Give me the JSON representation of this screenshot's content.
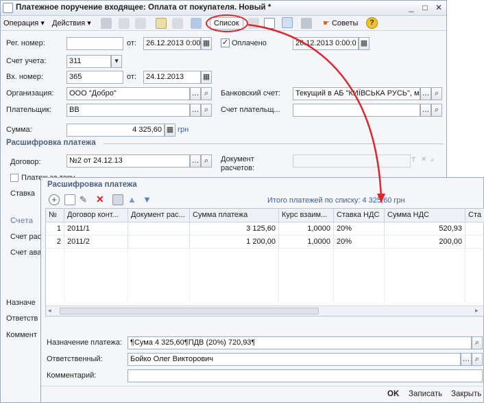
{
  "main_window": {
    "title": "Платежное поручение входящее: Оплата от покупателя. Новый *",
    "toolbar": {
      "operation_label": "Операция",
      "actions_label": "Действия",
      "list_label": "Список",
      "tips_label": "Советы"
    },
    "fields": {
      "reg_number_label": "Рег. номер:",
      "reg_number_value": "",
      "from_label": "от:",
      "reg_date": "26.12.2013 0:00",
      "paid_label": "Оплачено",
      "paid_date": "26.12.2013 0:00:0",
      "account_label": "Счет учета:",
      "account_value": "311",
      "incoming_number_label": "Вх. номер:",
      "incoming_number_value": "365",
      "from2_label": "от:",
      "incoming_date": "24.12.2013",
      "organization_label": "Организация:",
      "organization_value": "ООО \"Добро\"",
      "bank_account_label": "Банковский счет:",
      "bank_account_value": "Текущий в АБ \"КИЇВСЬКА РУСЬ\", м",
      "payer_label": "Плательщик:",
      "payer_value": "ВВ",
      "payer_account_label": "Счет плательщ...",
      "payer_account_value": "",
      "amount_label": "Сумма:",
      "amount_value": "4 325,60",
      "currency": "грн"
    },
    "breakdown_section": "Расшифровка платежа",
    "contract_label": "Договор:",
    "contract_value": "№2 от 24.12.13",
    "settlement_doc_label": "Документ расчетов:",
    "settlement_doc_value": "",
    "left_partial": {
      "payment_checkbox_label": "Платеж за тару",
      "rate_label": "Ставка",
      "account_section": "Счета",
      "settlement_account_label": "Счет рас",
      "advance_account_label": "Счет ава",
      "purpose_label": "Назначе",
      "responsible_label": "Ответств",
      "comment_label": "Коммент"
    }
  },
  "list_window": {
    "title": "Расшифровка платежа",
    "total_text": "Итого платежей по списку: 4 325,60 грн",
    "columns": [
      "№",
      "Договор конт...",
      "Документ рас...",
      "Сумма платежа",
      "Курс взаим...",
      "Ставка НДС",
      "Сумма НДС",
      "Ста"
    ],
    "rows": [
      [
        "1",
        "2011/1",
        "",
        "3 125,60",
        "1,0000",
        "20%",
        "520,93",
        ""
      ],
      [
        "2",
        "2011/2",
        "",
        "1 200,00",
        "1,0000",
        "20%",
        "200,00",
        ""
      ]
    ],
    "purpose_label": "Назначение платежа:",
    "purpose_value": "¶Сума 4 325,60¶ПДВ (20%) 720,93¶",
    "responsible_label": "Ответственный:",
    "responsible_value": "Бойко Олег Викторович",
    "comment_label": "Комментарий:",
    "comment_value": "",
    "ok_label": "OK",
    "save_label": "Записать",
    "close_label": "Закрыть"
  },
  "colors": {
    "accent_red": "#e0242c",
    "section_blue": "#4b5e86",
    "link_blue": "#3b5ea8"
  }
}
